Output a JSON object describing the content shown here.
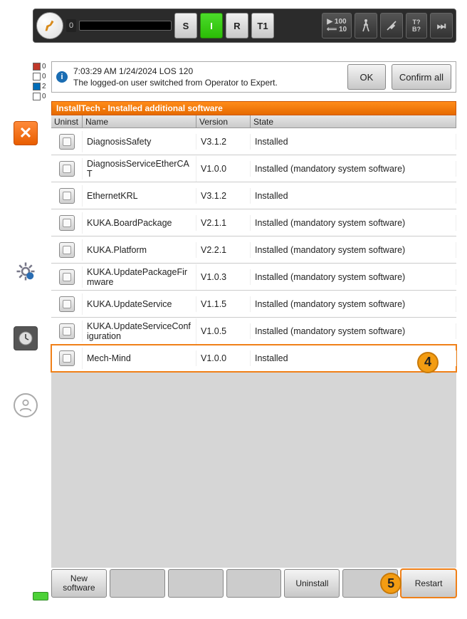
{
  "topbar": {
    "counter": "0",
    "btn_s": "S",
    "btn_i": "I",
    "btn_r": "R",
    "btn_t1": "T1",
    "speed_top": "100",
    "speed_bot": "10",
    "btn_b": "B?",
    "btn_t_small": "T?"
  },
  "leftstatus": [
    {
      "color": "red",
      "n": "0"
    },
    {
      "color": "",
      "n": "0"
    },
    {
      "color": "blue",
      "n": "2"
    },
    {
      "color": "",
      "n": "0"
    }
  ],
  "message": {
    "timestamp": "7:03:29 AM 1/24/2024 LOS 120",
    "text": "The logged-on user switched from Operator to Expert.",
    "ok": "OK",
    "confirm_all": "Confirm all"
  },
  "title": "InstallTech - Installed additional software",
  "columns": {
    "uninst": "Uninst",
    "name": "Name",
    "version": "Version",
    "state": "State"
  },
  "rows": [
    {
      "name": "DiagnosisSafety",
      "version": "V3.1.2",
      "state": "Installed",
      "hl": false
    },
    {
      "name": "DiagnosisServiceEtherCAT",
      "version": "V1.0.0",
      "state": "Installed (mandatory system software)",
      "hl": false
    },
    {
      "name": "EthernetKRL",
      "version": "V3.1.2",
      "state": "Installed",
      "hl": false
    },
    {
      "name": "KUKA.BoardPackage",
      "version": "V2.1.1",
      "state": "Installed (mandatory system software)",
      "hl": false
    },
    {
      "name": "KUKA.Platform",
      "version": "V2.2.1",
      "state": "Installed (mandatory system software)",
      "hl": false
    },
    {
      "name": "KUKA.UpdatePackageFirmware",
      "version": "V1.0.3",
      "state": "Installed (mandatory system software)",
      "hl": false
    },
    {
      "name": "KUKA.UpdateService",
      "version": "V1.1.5",
      "state": "Installed (mandatory system software)",
      "hl": false
    },
    {
      "name": "KUKA.UpdateServiceConfiguration",
      "version": "V1.0.5",
      "state": "Installed (mandatory system software)",
      "hl": false
    },
    {
      "name": "Mech-Mind",
      "version": "V1.0.0",
      "state": "Installed",
      "hl": true
    }
  ],
  "callouts": {
    "row": "4",
    "restart": "5"
  },
  "bottom": {
    "new_software": "New software",
    "uninstall": "Uninstall",
    "restart": "Restart"
  }
}
